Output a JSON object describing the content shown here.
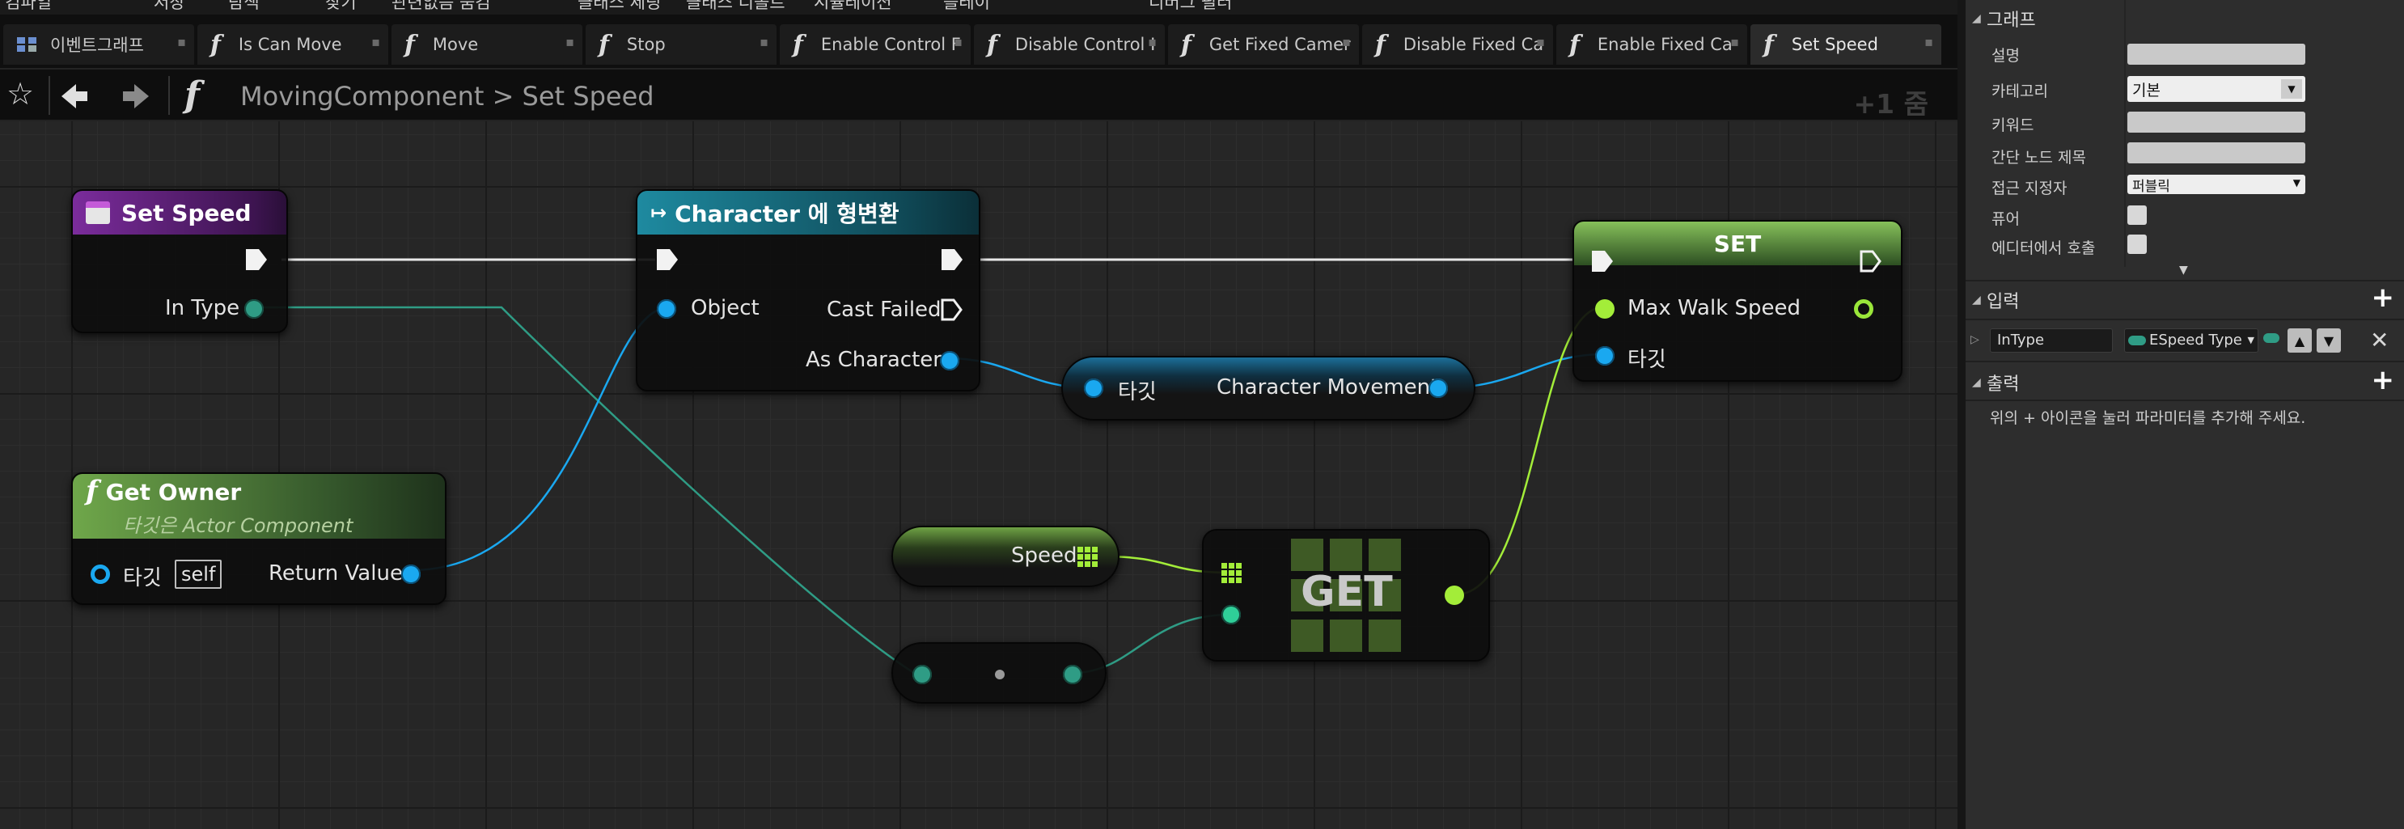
{
  "toolbar": {
    "items": [
      "컴파일",
      "저장",
      "탐색",
      "찾기",
      "관련없음 숨김",
      "클래스 세팅",
      "클래스 디폴트",
      "시뮬레이션",
      "플레이",
      "디버그 필터"
    ]
  },
  "tabs": [
    {
      "label": "이벤트그래프",
      "icon": "event-graph-icon"
    },
    {
      "label": "Is Can Move",
      "icon": "function-icon"
    },
    {
      "label": "Move",
      "icon": "function-icon"
    },
    {
      "label": "Stop",
      "icon": "function-icon"
    },
    {
      "label": "Enable Control F",
      "icon": "function-icon"
    },
    {
      "label": "Disable Control I",
      "icon": "function-icon"
    },
    {
      "label": "Get Fixed Camer",
      "icon": "function-icon"
    },
    {
      "label": "Disable Fixed Ca",
      "icon": "function-icon"
    },
    {
      "label": "Enable Fixed Ca",
      "icon": "function-icon"
    },
    {
      "label": "Set Speed",
      "icon": "function-icon"
    }
  ],
  "breadcrumb": {
    "path": "MovingComponent > Set Speed",
    "zoom": "+1 줌"
  },
  "nodes": {
    "set_speed": {
      "title": "Set Speed",
      "pin_in_type": "In Type"
    },
    "cast": {
      "title": "Character 에 형변환",
      "pin_object": "Object",
      "pin_cast_failed": "Cast Failed",
      "pin_as_character": "As Character"
    },
    "set": {
      "title": "SET",
      "pin_max_walk_speed": "Max Walk Speed",
      "pin_target": "타깃"
    },
    "char_movement": {
      "pin_target": "타깃",
      "pin_output": "Character Movement"
    },
    "get_owner": {
      "title": "Get Owner",
      "subtitle_prefix": "타깃은",
      "subtitle_class": "Actor Component",
      "pin_target": "타깃",
      "self_label": "self",
      "pin_return": "Return Value"
    },
    "speed_var": {
      "label": "Speed"
    },
    "get": {
      "title": "GET"
    }
  },
  "panel": {
    "graph_section": "그래프",
    "rows": [
      {
        "label": "설명",
        "type": "input",
        "value": ""
      },
      {
        "label": "카테고리",
        "type": "select",
        "value": "기본"
      },
      {
        "label": "키워드",
        "type": "input",
        "value": ""
      },
      {
        "label": "간단 노드 제목",
        "type": "input",
        "value": ""
      },
      {
        "label": "접근 지정자",
        "type": "select",
        "value": "퍼블릭"
      },
      {
        "label": "퓨어",
        "type": "checkbox",
        "value": false
      },
      {
        "label": "에디터에서 호출",
        "type": "checkbox",
        "value": false
      }
    ],
    "inputs_section": "입력",
    "input_param": {
      "name": "InType",
      "type": "ESpeed Type"
    },
    "outputs_section": "출력",
    "outputs_hint": "위의 + 아이콘을 눌러 파라미터를 추가해 주세요."
  }
}
